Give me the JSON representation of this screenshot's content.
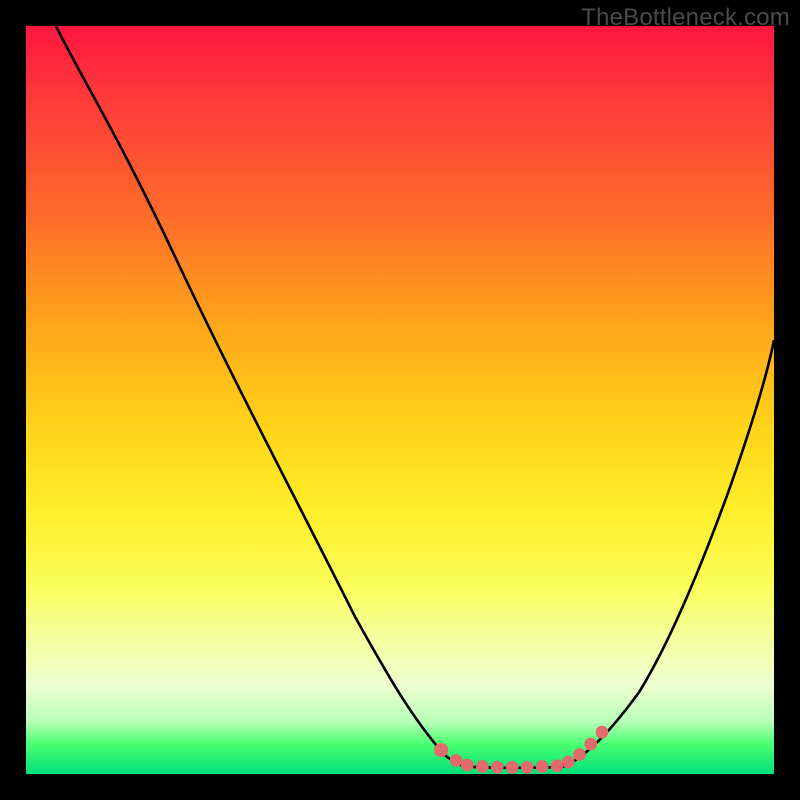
{
  "watermark": "TheBottleneck.com",
  "colors": {
    "background": "#000000",
    "curve": "#000000",
    "marker": "#e26a6a",
    "gradient_stops": [
      {
        "pos": 0.0,
        "hex": "#ff163e"
      },
      {
        "pos": 0.1,
        "hex": "#ff3b3b"
      },
      {
        "pos": 0.25,
        "hex": "#ff6a2a"
      },
      {
        "pos": 0.4,
        "hex": "#ffa61a"
      },
      {
        "pos": 0.55,
        "hex": "#ffd81a"
      },
      {
        "pos": 0.65,
        "hex": "#ffee2a"
      },
      {
        "pos": 0.75,
        "hex": "#faff5a"
      },
      {
        "pos": 0.82,
        "hex": "#f4ffa0"
      },
      {
        "pos": 0.88,
        "hex": "#efffd0"
      },
      {
        "pos": 0.93,
        "hex": "#b8ffb8"
      },
      {
        "pos": 0.96,
        "hex": "#4aff70"
      },
      {
        "pos": 1.0,
        "hex": "#00e07a"
      }
    ]
  },
  "chart_data": {
    "type": "line",
    "title": "",
    "xlabel": "",
    "ylabel": "",
    "xlim": [
      0,
      100
    ],
    "ylim": [
      0,
      100
    ],
    "series": [
      {
        "name": "left-branch",
        "x": [
          4,
          10,
          20,
          30,
          40,
          46,
          50,
          54,
          56,
          58
        ],
        "y": [
          100,
          89,
          69,
          49,
          29,
          16,
          8,
          3,
          1.5,
          1
        ]
      },
      {
        "name": "right-branch",
        "x": [
          72,
          76,
          80,
          84,
          88,
          92,
          96,
          100
        ],
        "y": [
          1,
          3,
          7,
          13,
          22,
          33,
          45,
          58
        ]
      },
      {
        "name": "bottom-flat",
        "x": [
          58,
          62,
          66,
          70,
          72
        ],
        "y": [
          1,
          0.8,
          0.8,
          0.9,
          1
        ]
      }
    ],
    "markers": {
      "name": "highlight-points",
      "color": "#e26a6a",
      "x": [
        55.5,
        57.5,
        59,
        61,
        63,
        65,
        67,
        69,
        71,
        72.5,
        74,
        75.5,
        77
      ],
      "y": [
        3.2,
        1.8,
        1.2,
        1.0,
        0.9,
        0.9,
        0.9,
        1.0,
        1.1,
        1.6,
        2.6,
        4.0,
        5.6
      ],
      "r": [
        7,
        6,
        6,
        6,
        6,
        6,
        6,
        6,
        6,
        6,
        6,
        6,
        6
      ]
    }
  }
}
